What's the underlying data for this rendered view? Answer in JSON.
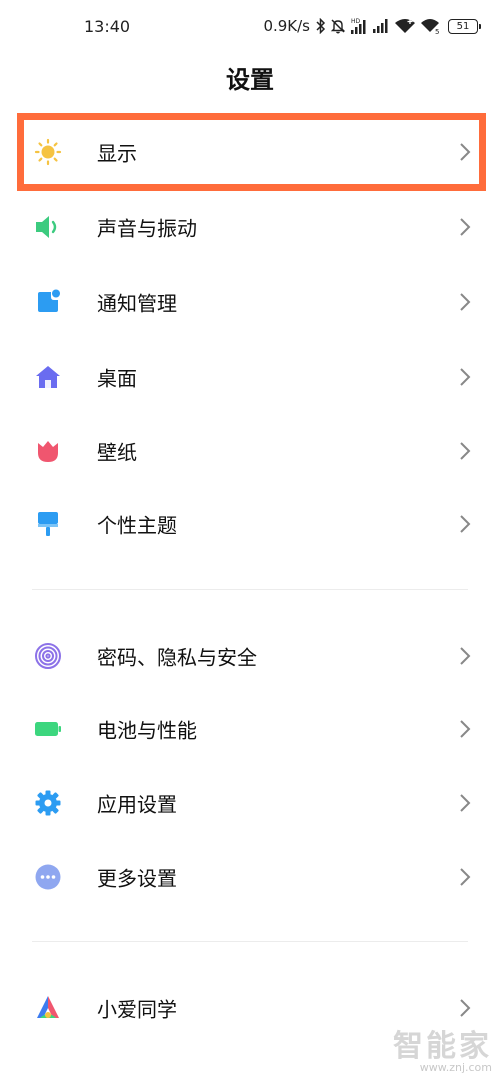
{
  "status_bar": {
    "time": "13:40",
    "net_speed": "0.9K/s",
    "battery": "51",
    "icons": [
      "bluetooth-icon",
      "mute-icon",
      "hd-signal-icon",
      "signal-icon",
      "wifi-icon",
      "wifi-5g-icon",
      "battery-icon"
    ]
  },
  "header": {
    "title": "设置"
  },
  "settings": {
    "group1": [
      {
        "label": "显示",
        "icon": "brightness-icon",
        "color": "#F5C342"
      },
      {
        "label": "声音与振动",
        "icon": "speaker-icon",
        "color": "#3CCB7F"
      },
      {
        "label": "通知管理",
        "icon": "notification-icon",
        "color": "#2C9CF2"
      },
      {
        "label": "桌面",
        "icon": "home-icon",
        "color": "#6A6CF0"
      },
      {
        "label": "壁纸",
        "icon": "tulip-icon",
        "color": "#F0566F"
      },
      {
        "label": "个性主题",
        "icon": "brush-icon",
        "color": "#2C9CF2"
      }
    ],
    "group2": [
      {
        "label": "密码、隐私与安全",
        "icon": "fingerprint-icon",
        "color": "#8C72E8"
      },
      {
        "label": "电池与性能",
        "icon": "battery-icon",
        "color": "#3CD67E"
      },
      {
        "label": "应用设置",
        "icon": "gear-icon",
        "color": "#2C9CF2"
      },
      {
        "label": "更多设置",
        "icon": "more-icon",
        "color": "#8FA7F0"
      }
    ],
    "group3": [
      {
        "label": "小爱同学",
        "icon": "xiaoai-icon",
        "color": "#3C7CF0"
      }
    ]
  },
  "highlight_color": "#FF6C3B",
  "watermark": {
    "main": "智能家",
    "sub": "www.znj.com"
  }
}
